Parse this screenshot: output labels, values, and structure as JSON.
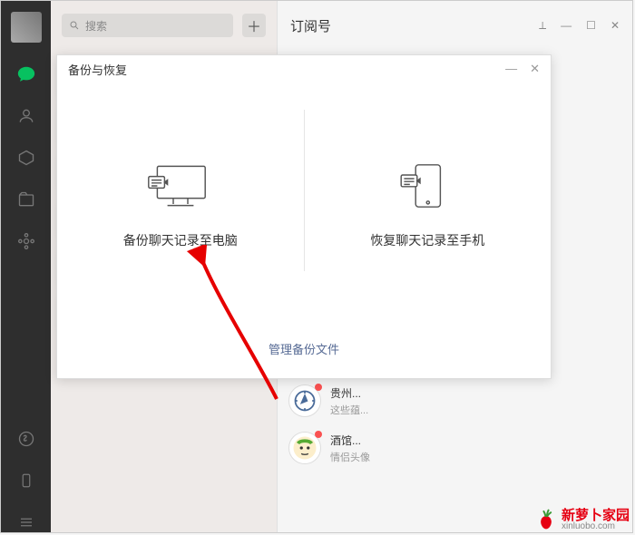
{
  "sidebar": {
    "icons": [
      "chat",
      "contacts",
      "folder",
      "files",
      "apps"
    ],
    "bottom": [
      "miniprogram",
      "phone",
      "menu"
    ]
  },
  "search": {
    "placeholder": "搜索"
  },
  "right": {
    "title": "订阅号"
  },
  "modal": {
    "title": "备份与恢复",
    "backup_label": "备份聊天记录至电脑",
    "restore_label": "恢复聊天记录至手机",
    "manage_link": "管理备份文件"
  },
  "chats": [
    {
      "name": "",
      "sub": ""
    },
    {
      "name": "贵州...",
      "sub": "这些蕴..."
    },
    {
      "name": "",
      "sub": ""
    },
    {
      "name": "酒馆...",
      "sub": "情侣头像"
    },
    {
      "name": "",
      "sub": ""
    }
  ],
  "watermark": {
    "cn": "新萝卜家园",
    "en": "xinluobo.com"
  }
}
